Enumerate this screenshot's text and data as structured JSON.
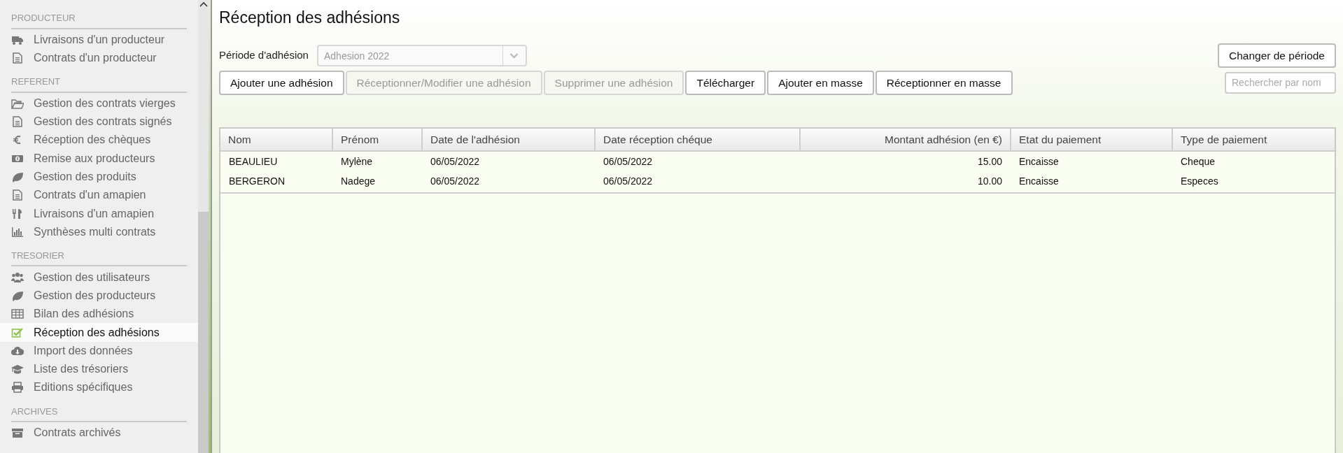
{
  "sidebar": {
    "sections": [
      {
        "heading": "PRODUCTEUR",
        "items": [
          {
            "label": "Livraisons d'un producteur",
            "selected": false
          },
          {
            "label": "Contrats d'un producteur",
            "selected": false
          }
        ]
      },
      {
        "heading": "REFERENT",
        "items": [
          {
            "label": "Gestion des contrats vierges",
            "selected": false
          },
          {
            "label": "Gestion des contrats signés",
            "selected": false
          },
          {
            "label": "Réception des chèques",
            "selected": false
          },
          {
            "label": "Remise aux producteurs",
            "selected": false
          },
          {
            "label": "Gestion des produits",
            "selected": false
          },
          {
            "label": "Contrats d'un amapien",
            "selected": false
          },
          {
            "label": "Livraisons d'un amapien",
            "selected": false
          },
          {
            "label": "Synthèses multi contrats",
            "selected": false
          }
        ]
      },
      {
        "heading": "TRESORIER",
        "items": [
          {
            "label": "Gestion des utilisateurs",
            "selected": false
          },
          {
            "label": "Gestion des producteurs",
            "selected": false
          },
          {
            "label": "Bilan des adhésions",
            "selected": false
          },
          {
            "label": "Réception des adhésions",
            "selected": true
          },
          {
            "label": "Import des données",
            "selected": false
          },
          {
            "label": "Liste des trésoriers",
            "selected": false
          },
          {
            "label": "Editions spécifiques",
            "selected": false
          }
        ]
      },
      {
        "heading": "ARCHIVES",
        "items": [
          {
            "label": "Contrats archivés",
            "selected": false
          }
        ]
      }
    ]
  },
  "page": {
    "title": "Réception des adhésions",
    "period": {
      "label": "Période d'adhésion",
      "value": "Adhesion 2022",
      "disabled": true
    },
    "change_button": "Changer de période",
    "toolbar": [
      {
        "label": "Ajouter une adhésion",
        "disabled": false
      },
      {
        "label": "Réceptionner/Modifier une adhésion",
        "disabled": true
      },
      {
        "label": "Supprimer une adhésion",
        "disabled": true
      },
      {
        "label": "Télécharger",
        "disabled": false
      },
      {
        "label": "Ajouter en masse",
        "disabled": false
      },
      {
        "label": "Réceptionner en masse",
        "disabled": false
      }
    ],
    "search": {
      "placeholder": "Rechercher par nom"
    }
  },
  "table": {
    "columns": [
      "Nom",
      "Prénom",
      "Date de l'adhésion",
      "Date réception chéque",
      "Montant adhésion (en €)",
      "Etat du paiement",
      "Type de paiement"
    ],
    "rows": [
      [
        "BEAULIEU",
        "Mylène",
        "06/05/2022",
        "06/05/2022",
        "15.00",
        "Encaisse",
        "Cheque"
      ],
      [
        "BERGERON",
        "Nadege",
        "06/05/2022",
        "06/05/2022",
        "10.00",
        "Encaisse",
        "Especes"
      ]
    ]
  }
}
